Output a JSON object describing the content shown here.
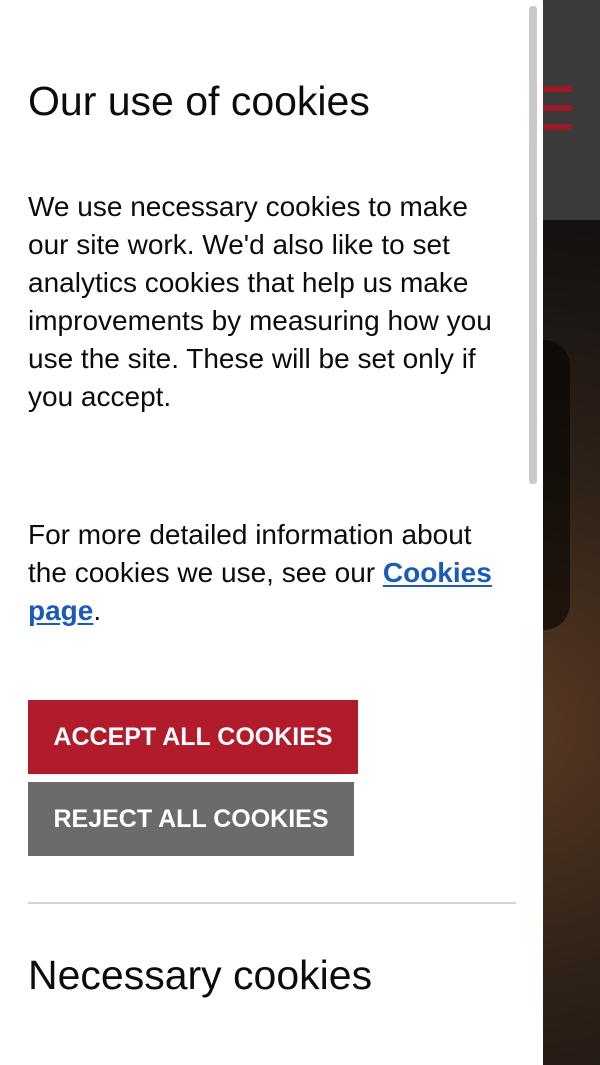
{
  "cookie_banner": {
    "title": "Our use of cookies",
    "intro": "We use necessary cookies to make our site work. We'd also like to set analytics cookies that help us make improvements by measuring how you use the site. These will be set only if you accept.",
    "more_info_prefix": "For more detailed information about the cookies we use, see our ",
    "more_info_link": "Cookies page",
    "more_info_suffix": ".",
    "accept_button": "ACCEPT ALL COOKIES",
    "reject_button": "REJECT ALL COOKIES",
    "necessary_heading": "Necessary cookies"
  },
  "background_page": {
    "menu_icon": "hamburger-menu-icon"
  },
  "colors": {
    "accept": "#b11b2c",
    "reject": "#6b6b6b",
    "link": "#1a5ab8",
    "menu_icon": "#9b1a28"
  }
}
